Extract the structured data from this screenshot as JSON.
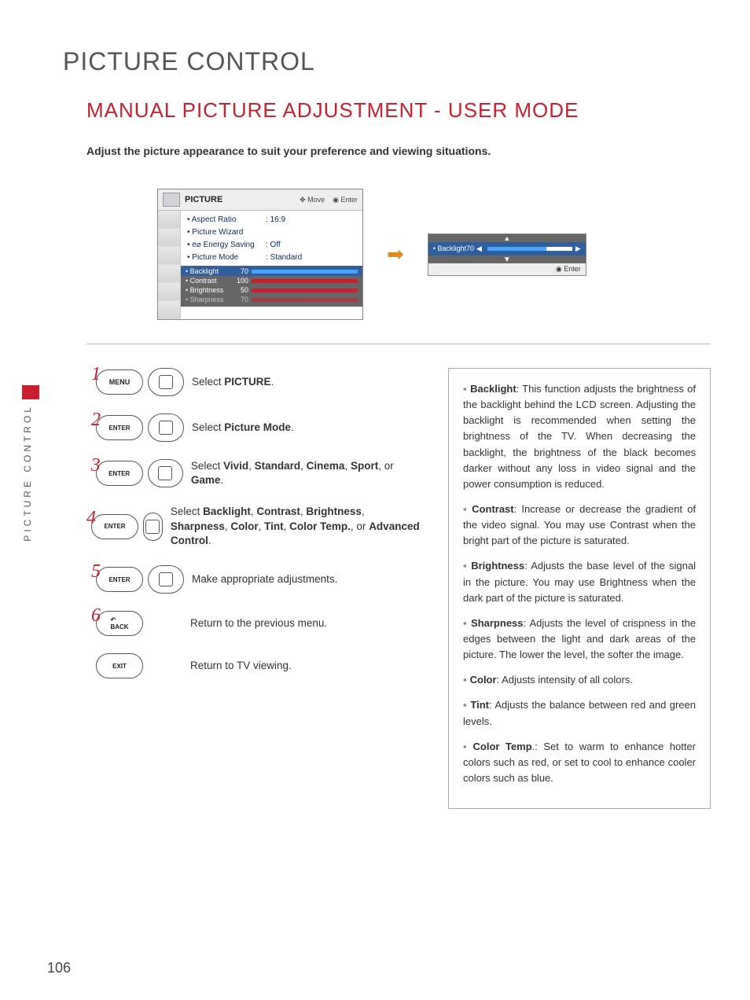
{
  "page": {
    "section_title": "PICTURE CONTROL",
    "title": "MANUAL PICTURE ADJUSTMENT - USER MODE",
    "intro": "Adjust the picture appearance to suit your preference and viewing situations.",
    "side_tab": "PICTURE CONTROL",
    "number": "106"
  },
  "osd": {
    "title": "PICTURE",
    "hint_move": "Move",
    "hint_enter": "Enter",
    "items": [
      {
        "label": "Aspect Ratio",
        "value": ": 16:9"
      },
      {
        "label": "Picture Wizard",
        "value": ""
      },
      {
        "label": "Energy Saving",
        "value": ": Off",
        "eco": true
      },
      {
        "label": "Picture Mode",
        "value": ": Standard"
      }
    ],
    "sub": [
      {
        "label": "• Backlight",
        "value": "70",
        "hl": true
      },
      {
        "label": "• Contrast",
        "value": "100"
      },
      {
        "label": "• Brightness",
        "value": "50"
      },
      {
        "label": "• Sharpness",
        "value": "70"
      }
    ]
  },
  "osd2": {
    "label": "• Backlight",
    "value": "70",
    "enter": "Enter"
  },
  "buttons": {
    "menu": "MENU",
    "enter": "ENTER",
    "back": "BACK",
    "exit": "EXIT"
  },
  "steps": {
    "n1": "1",
    "n2": "2",
    "n3": "3",
    "n4": "4",
    "n5": "5",
    "n6": "6",
    "s1_a": "Select ",
    "s1_b": "PICTURE",
    "s1_c": ".",
    "s2_a": "Select ",
    "s2_b": "Picture Mode",
    "s2_c": ".",
    "s3_a": "Select ",
    "s3_b": "Vivid",
    "s3_c": ",  ",
    "s3_d": "Standard",
    "s3_e": ", ",
    "s3_f": "Cinema",
    "s3_g": ", ",
    "s3_h": "Sport",
    "s3_i": ", or ",
    "s3_j": "Game",
    "s3_k": ".",
    "s4_a": "Select ",
    "s4_b": "Backlight",
    "s4_c": ", ",
    "s4_d": "Contrast",
    "s4_e": ", ",
    "s4_f": "Brightness",
    "s4_g": ", ",
    "s4_h": "Sharpness",
    "s4_i": ", ",
    "s4_j": "Color",
    "s4_k": ", ",
    "s4_l": "Tint",
    "s4_m": ", ",
    "s4_n": "Color Temp.",
    "s4_o": ", or ",
    "s4_p": "Advanced Control",
    "s4_q": ".",
    "s5": "Make appropriate adjustments.",
    "s6": "Return to the previous menu.",
    "s7": "Return to TV viewing."
  },
  "info": {
    "i1_t": "Backlight",
    "i1": ": This function adjusts the brightness of the backlight behind the LCD screen. Adjusting the backlight is recommended when setting the brightness of the TV. When decreasing the backlight, the brightness of the black becomes darker without any loss in video signal and the power consumption is reduced.",
    "i2_t": "Contrast",
    "i2": ": Increase or decrease the gradient of the video signal. You may use Contrast when the bright part of the picture is saturated.",
    "i3_t": "Brightness",
    "i3": ": Adjusts the base level of the signal in the picture. You may use Brightness when the dark part of the picture is saturated.",
    "i4_t": "Sharpness",
    "i4": ": Adjusts the level of crispness in the edges between the light and dark areas of the picture. The lower the level, the softer the image.",
    "i5_t": "Color",
    "i5": ": Adjusts intensity of all colors.",
    "i6_t": "Tint",
    "i6": ": Adjusts the balance between red and green levels.",
    "i7_t": "Color Temp",
    "i7": ".: Set to warm to enhance hotter colors such as red, or set to cool to enhance cooler colors such as blue."
  }
}
